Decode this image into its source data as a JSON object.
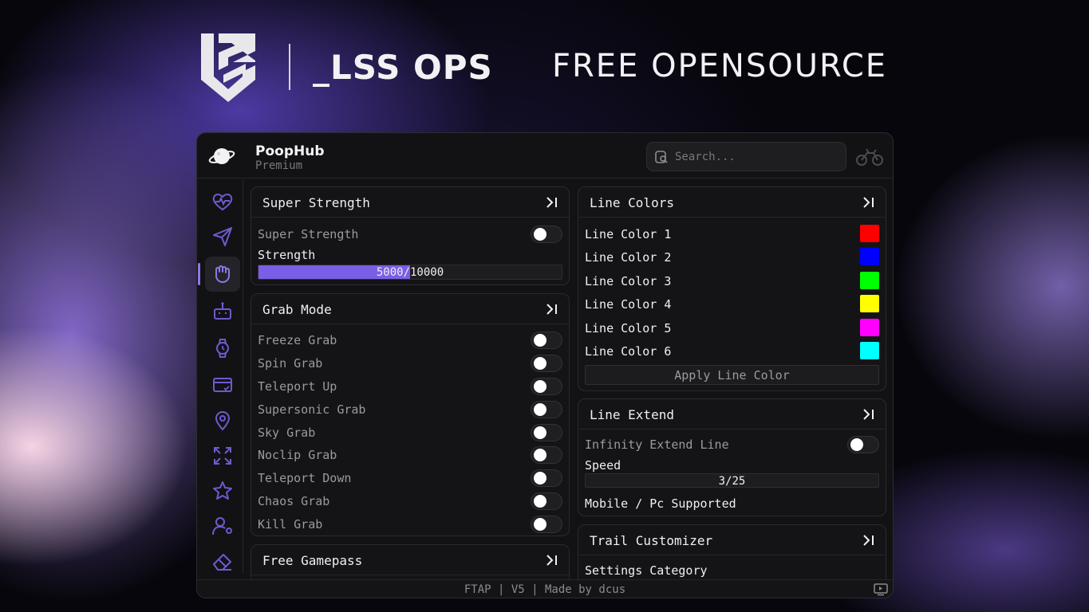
{
  "banner": {
    "brand_name": "_LSS OPS",
    "tagline": "FREE OPENSOURCE"
  },
  "app": {
    "title": "PoopHub",
    "subtitle": "Premium",
    "search_placeholder": "Search...",
    "footer": "FTAP | V5 | Made by dcus"
  },
  "sidebar": {
    "items": [
      {
        "icon": "heart-pulse-icon"
      },
      {
        "icon": "send-icon"
      },
      {
        "icon": "grab-hand-icon",
        "active": true
      },
      {
        "icon": "robot-icon"
      },
      {
        "icon": "watch-icon"
      },
      {
        "icon": "card-icon"
      },
      {
        "icon": "map-pin-icon"
      },
      {
        "icon": "expand-icon"
      },
      {
        "icon": "star-icon"
      },
      {
        "icon": "user-settings-icon"
      },
      {
        "icon": "eraser-icon"
      }
    ]
  },
  "super_strength": {
    "title": "Super Strength",
    "toggle_label": "Super Strength",
    "slider_label": "Strength",
    "slider_value": 5000,
    "slider_max": 10000,
    "slider_text": "5000/10000"
  },
  "grab_mode": {
    "title": "Grab Mode",
    "items": [
      "Freeze Grab",
      "Spin Grab",
      "Teleport Up",
      "Supersonic Grab",
      "Sky Grab",
      "Noclip Grab",
      "Teleport Down",
      "Chaos Grab",
      "Kill Grab"
    ]
  },
  "free_gamepass": {
    "title": "Free Gamepass"
  },
  "line_colors": {
    "title": "Line Colors",
    "items": [
      {
        "label": "Line Color 1",
        "color": "#ff0000"
      },
      {
        "label": "Line Color 2",
        "color": "#0000ff"
      },
      {
        "label": "Line Color 3",
        "color": "#00ff00"
      },
      {
        "label": "Line Color 4",
        "color": "#ffff00"
      },
      {
        "label": "Line Color 5",
        "color": "#ff00ff"
      },
      {
        "label": "Line Color 6",
        "color": "#00ffff"
      }
    ],
    "apply_label": "Apply Line Color"
  },
  "line_extend": {
    "title": "Line Extend",
    "toggle_label": "Infinity Extend Line",
    "slider_label": "Speed",
    "slider_value": 3,
    "slider_max": 25,
    "slider_text": "3/25",
    "note": "Mobile / Pc Supported"
  },
  "trail_customizer": {
    "title": "Trail Customizer",
    "category_label": "Settings Category"
  },
  "colors": {
    "accent": "#7a5ee6",
    "panel_bg": "#141416",
    "window_bg": "#121214"
  }
}
